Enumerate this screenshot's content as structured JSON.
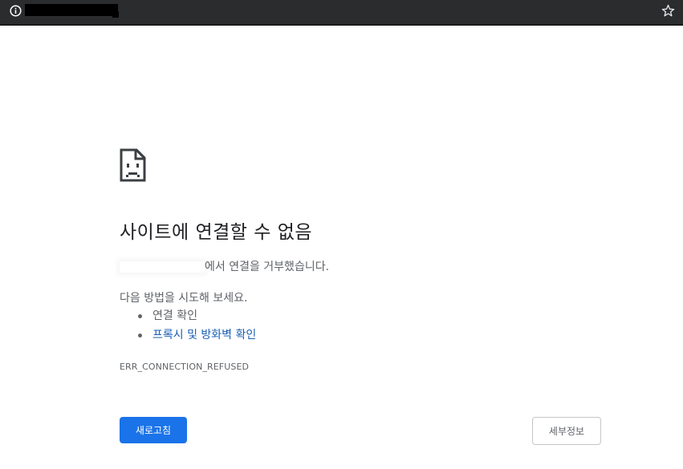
{
  "browser": {
    "info_icon": "info-icon",
    "star_icon": "bookmark-star-icon"
  },
  "error_page": {
    "icon": "sad-page-icon",
    "title": "사이트에 연결할 수 없음",
    "refused_suffix": "에서 연결을 거부했습니다.",
    "try_text": "다음 방법을 시도해 보세요.",
    "suggestions": [
      "연결 확인",
      "프록시 및 방화벽 확인"
    ],
    "error_code": "ERR_CONNECTION_REFUSED",
    "reload_label": "새로고침",
    "details_label": "세부정보",
    "accent_color": "#1a73e8",
    "link_color": "#1a5fb4"
  }
}
